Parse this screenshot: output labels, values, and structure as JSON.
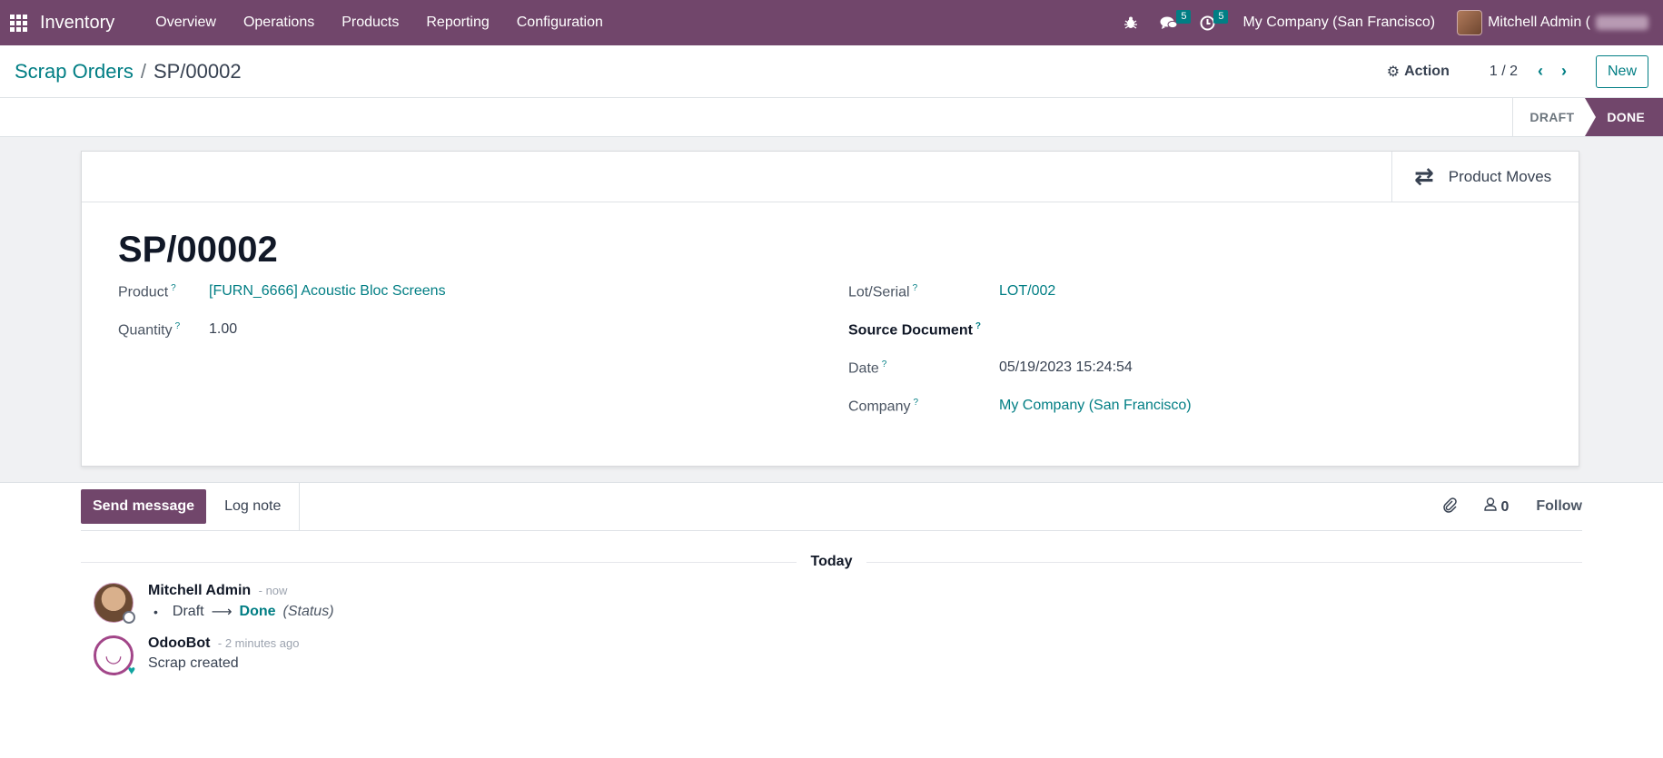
{
  "navbar": {
    "brand": "Inventory",
    "menu": [
      "Overview",
      "Operations",
      "Products",
      "Reporting",
      "Configuration"
    ],
    "messages_count": "5",
    "activities_count": "5",
    "company": "My Company (San Francisco)",
    "user": "Mitchell Admin ("
  },
  "control_panel": {
    "breadcrumb_parent": "Scrap Orders",
    "breadcrumb_sep": "/",
    "breadcrumb_current": "SP/00002",
    "action_label": "Action",
    "pager": "1 / 2",
    "new_label": "New"
  },
  "statusbar": {
    "stages": [
      "DRAFT",
      "DONE"
    ],
    "active": "DONE"
  },
  "sheet": {
    "smart_button": "Product Moves",
    "name": "SP/00002",
    "fields_left": [
      {
        "label": "Product",
        "value": "[FURN_6666] Acoustic Bloc Screens"
      },
      {
        "label": "Quantity",
        "value": "1.00"
      }
    ],
    "fields_right": [
      {
        "label": "Lot/Serial",
        "value": "LOT/002"
      },
      {
        "label": "Source Document",
        "value": ""
      },
      {
        "label": "Date",
        "value": "05/19/2023 15:24:54"
      },
      {
        "label": "Company",
        "value": "My Company (San Francisco)"
      }
    ]
  },
  "chatter": {
    "send_message": "Send message",
    "log_note": "Log note",
    "followers_count": "0",
    "follow": "Follow",
    "day": "Today",
    "messages": [
      {
        "author": "Mitchell Admin",
        "time": "- now",
        "old_value": "Draft",
        "new_value": "Done",
        "field": "(Status)"
      },
      {
        "author": "OdooBot",
        "time": "- 2 minutes ago",
        "body": "Scrap created"
      }
    ]
  },
  "colors": {
    "primary": "#71466b",
    "link": "#017e84"
  }
}
